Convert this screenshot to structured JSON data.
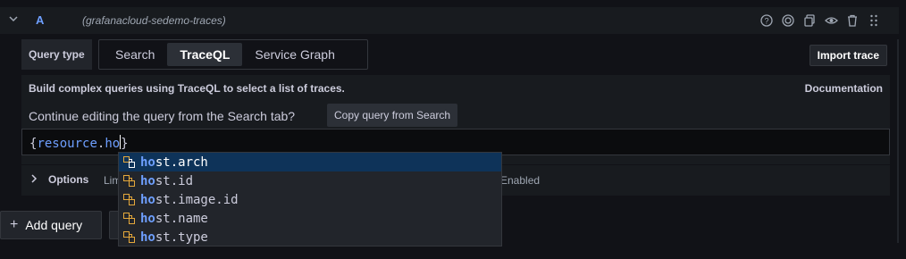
{
  "query_row": {
    "letter": "A",
    "datasource": "(grafanacloud-sedemo-traces)"
  },
  "query_type": {
    "label": "Query type",
    "options": [
      "Search",
      "TraceQL",
      "Service Graph"
    ],
    "selected": "TraceQL",
    "import_label": "Import trace"
  },
  "info": {
    "description": "Build complex queries using TraceQL to select a list of traces.",
    "documentation_link": "Documentation",
    "continue_text": "Continue editing the query from the Search tab?",
    "copy_button": "Copy query from Search"
  },
  "editor": {
    "open_brace": "{",
    "field": "resource",
    "dot": ".",
    "typed": "ho",
    "close_brace": "}"
  },
  "options_row": {
    "label": "Options",
    "limit_prefix": "Lim",
    "enabled_text": "Enabled"
  },
  "add_query_label": "Add query",
  "suggestions": [
    {
      "match": "ho",
      "rest": "st.arch",
      "selected": true
    },
    {
      "match": "ho",
      "rest": "st.id",
      "selected": false
    },
    {
      "match": "ho",
      "rest": "st.image.id",
      "selected": false
    },
    {
      "match": "ho",
      "rest": "st.name",
      "selected": false
    },
    {
      "match": "ho",
      "rest": "st.type",
      "selected": false
    }
  ],
  "colors": {
    "background": "#111217",
    "panel": "#181b1f",
    "accent_blue": "#6e9fff",
    "selected_suggestion": "#0e3359",
    "suggestion_icon": "#e5a83b"
  }
}
